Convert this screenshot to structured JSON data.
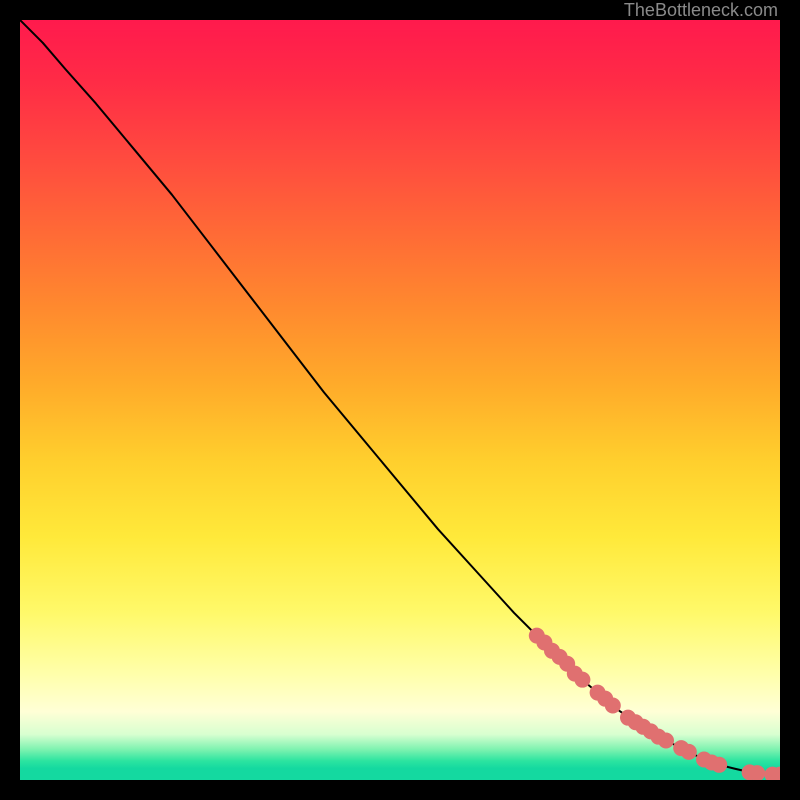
{
  "watermark": "TheBottleneck.com",
  "colors": {
    "line": "#000000",
    "marker_fill": "#e07070",
    "marker_stroke": "#c45a5a"
  },
  "chart_data": {
    "type": "line",
    "title": "",
    "xlabel": "",
    "ylabel": "",
    "xlim": [
      0,
      100
    ],
    "ylim": [
      0,
      100
    ],
    "grid": false,
    "series": [
      {
        "name": "curve",
        "x": [
          0,
          3,
          6,
          10,
          15,
          20,
          25,
          30,
          35,
          40,
          45,
          50,
          55,
          60,
          65,
          70,
          73,
          76,
          79,
          82,
          85,
          88,
          90,
          92,
          94,
          95.5,
          97,
          98,
          99,
          100
        ],
        "y": [
          100,
          97,
          93.5,
          89,
          83,
          77,
          70.5,
          64,
          57.5,
          51,
          45,
          39,
          33,
          27.5,
          22,
          17,
          14,
          11.5,
          9,
          7,
          5.2,
          3.7,
          2.7,
          2.0,
          1.5,
          1.15,
          0.9,
          0.75,
          0.7,
          0.7
        ]
      }
    ],
    "markers": {
      "name": "points",
      "x": [
        68,
        69,
        70,
        71,
        72,
        73,
        74,
        76,
        77,
        78,
        80,
        81,
        82,
        83,
        84,
        85,
        87,
        88,
        90,
        91,
        92,
        96,
        97,
        99,
        100
      ],
      "y": [
        19.0,
        18.1,
        17.0,
        16.2,
        15.3,
        14.0,
        13.2,
        11.5,
        10.7,
        9.8,
        8.2,
        7.6,
        7.0,
        6.4,
        5.7,
        5.2,
        4.2,
        3.7,
        2.7,
        2.3,
        2.0,
        1.0,
        0.9,
        0.7,
        0.7
      ]
    }
  }
}
